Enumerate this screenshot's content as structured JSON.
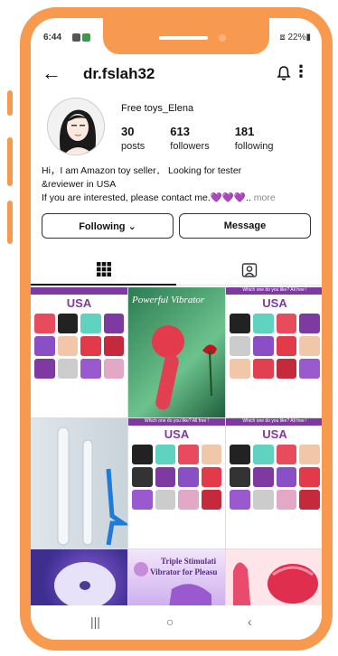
{
  "status": {
    "time": "6:44",
    "right": "⧈ 22%▮"
  },
  "header": {
    "username": "dr.fslah32",
    "back_icon": "←",
    "more_icon": "⋮"
  },
  "profile": {
    "full_name": "Free toys_Elena",
    "stats": [
      {
        "value": "30",
        "label": "posts"
      },
      {
        "value": "613",
        "label": "followers"
      },
      {
        "value": "181",
        "label": "following"
      }
    ],
    "bio_line1": "Hi，I am Amazon toy seller． Looking for tester",
    "bio_line2": "&reviewer in USA",
    "bio_line3": "If you are interested, please contact me.💜💜💜..",
    "bio_more": "more"
  },
  "buttons": {
    "following": "Following ⌄",
    "message": "Message"
  },
  "tabs": [
    "posts-grid",
    "tagged"
  ],
  "grid": {
    "card_title": "USA",
    "card_caption": "Which one do you like? All free !",
    "script_text": "Powerful Vibrator",
    "triple_text_1": "Triple Stimulati",
    "triple_text_2": "Vibrator for Pleasu"
  },
  "nav": {
    "recent": "|||",
    "home": "○",
    "back": "‹"
  },
  "colors": {
    "frame": "#f79a4f",
    "accent": "#7e3aa0"
  }
}
